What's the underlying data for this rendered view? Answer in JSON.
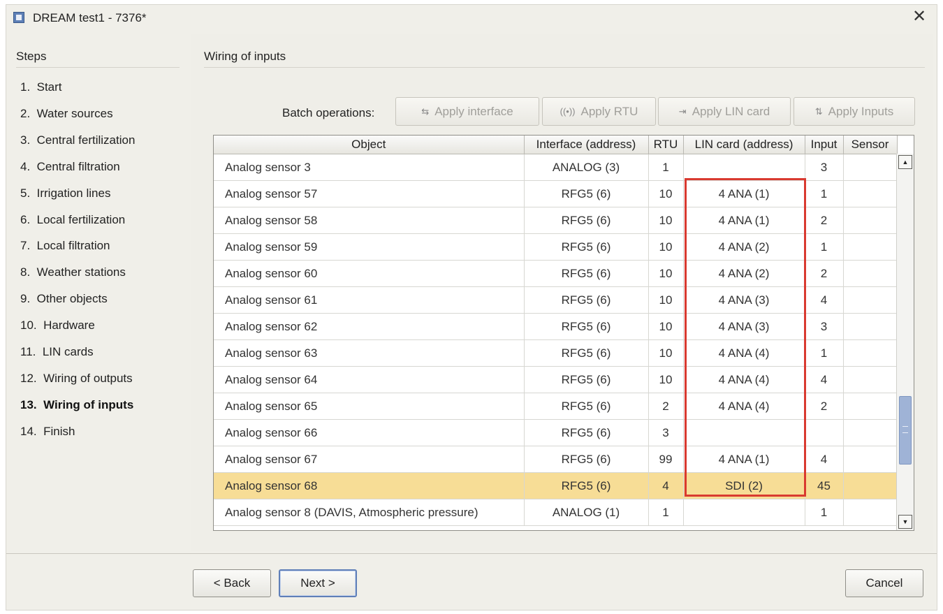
{
  "window": {
    "title": "DREAM test1 - 7376*",
    "close_glyph": "✕"
  },
  "steps": {
    "heading": "Steps",
    "items": [
      {
        "label": "1.  Start"
      },
      {
        "label": "2.  Water sources"
      },
      {
        "label": "3.  Central fertilization"
      },
      {
        "label": "4.  Central filtration"
      },
      {
        "label": "5.  Irrigation lines"
      },
      {
        "label": "6.  Local fertilization"
      },
      {
        "label": "7.  Local filtration"
      },
      {
        "label": "8.  Weather stations"
      },
      {
        "label": "9.  Other objects"
      },
      {
        "label": "10.  Hardware"
      },
      {
        "label": "11.  LIN cards"
      },
      {
        "label": "12.  Wiring of outputs"
      },
      {
        "label": "13.  Wiring of inputs",
        "active": true
      },
      {
        "label": "14.  Finish"
      }
    ]
  },
  "content": {
    "heading": "Wiring of inputs",
    "batch": {
      "label": "Batch operations:",
      "buttons": [
        {
          "label": "Apply interface",
          "icon": "usb-icon",
          "glyph": "⇆"
        },
        {
          "label": "Apply RTU",
          "icon": "rtu-icon",
          "glyph": "((•))"
        },
        {
          "label": "Apply LIN card",
          "icon": "lin-card-icon",
          "glyph": "⇥"
        },
        {
          "label": "Apply Inputs",
          "icon": "inputs-icon",
          "glyph": "⇅"
        }
      ]
    },
    "table": {
      "columns": [
        "Object",
        "Interface (address)",
        "RTU",
        "LIN card (address)",
        "Input",
        "Sensor"
      ],
      "rows": [
        [
          "Analog sensor 3",
          "ANALOG (3)",
          "1",
          "",
          "3",
          ""
        ],
        [
          "Analog sensor 57",
          "RFG5 (6)",
          "10",
          "4 ANA (1)",
          "1",
          ""
        ],
        [
          "Analog sensor 58",
          "RFG5 (6)",
          "10",
          "4 ANA (1)",
          "2",
          ""
        ],
        [
          "Analog sensor 59",
          "RFG5 (6)",
          "10",
          "4 ANA (2)",
          "1",
          ""
        ],
        [
          "Analog sensor 60",
          "RFG5 (6)",
          "10",
          "4 ANA (2)",
          "2",
          ""
        ],
        [
          "Analog sensor 61",
          "RFG5 (6)",
          "10",
          "4 ANA (3)",
          "4",
          ""
        ],
        [
          "Analog sensor 62",
          "RFG5 (6)",
          "10",
          "4 ANA (3)",
          "3",
          ""
        ],
        [
          "Analog sensor 63",
          "RFG5 (6)",
          "10",
          "4 ANA (4)",
          "1",
          ""
        ],
        [
          "Analog sensor 64",
          "RFG5 (6)",
          "10",
          "4 ANA (4)",
          "4",
          ""
        ],
        [
          "Analog sensor 65",
          "RFG5 (6)",
          "2",
          "4 ANA (4)",
          "2",
          ""
        ],
        [
          "Analog sensor 66",
          "RFG5 (6)",
          "3",
          "",
          "",
          ""
        ],
        [
          "Analog sensor 67",
          "RFG5 (6)",
          "99",
          "4 ANA (1)",
          "4",
          ""
        ],
        [
          "Analog sensor 68",
          "RFG5 (6)",
          "4",
          "SDI (2)",
          "45",
          ""
        ],
        [
          "Analog sensor 8  (DAVIS, Atmospheric pressure)",
          "ANALOG (1)",
          "1",
          "",
          "1",
          ""
        ]
      ],
      "selected_row_index": 12,
      "selected_row_color": "#f7dd96",
      "highlight_color": "#d93a30"
    }
  },
  "footer": {
    "back_label": "< Back",
    "next_label": "Next >",
    "cancel_label": "Cancel"
  }
}
